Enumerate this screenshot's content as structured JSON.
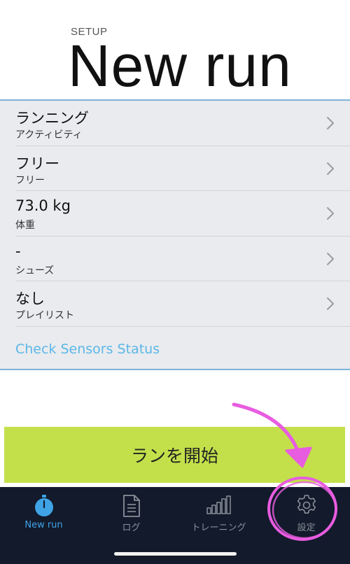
{
  "header": {
    "eyebrow": "SETUP",
    "title": "New run"
  },
  "settings": {
    "rows": [
      {
        "value": "ランニング",
        "caption": "アクティビティ",
        "icon": "chevron-right-icon"
      },
      {
        "value": "フリー",
        "caption": "フリー",
        "icon": "chevron-right-icon"
      },
      {
        "value": "73.0 kg",
        "caption": "体重",
        "icon": "chevron-right-icon"
      },
      {
        "value": "-",
        "caption": "シューズ",
        "icon": "chevron-right-icon"
      },
      {
        "value": "なし",
        "caption": "プレイリスト",
        "icon": "chevron-right-icon"
      }
    ],
    "sensor_link": "Check Sensors Status"
  },
  "start_button": {
    "label": "ランを開始"
  },
  "tabbar": {
    "tabs": [
      {
        "label": "New run",
        "icon": "stopwatch-icon",
        "active": true
      },
      {
        "label": "ログ",
        "icon": "document-icon",
        "active": false
      },
      {
        "label": "トレーニング",
        "icon": "bar-chart-icon",
        "active": false
      },
      {
        "label": "設定",
        "icon": "gear-icon",
        "active": false
      }
    ]
  },
  "colors": {
    "accent_blue": "#3fa3e6",
    "link_blue": "#5bb7e8",
    "start_button_green": "#c3e04b",
    "tabbar_bg": "#121a2b",
    "list_bg": "#e9ebee",
    "annotation_magenta": "#e85ce0"
  }
}
